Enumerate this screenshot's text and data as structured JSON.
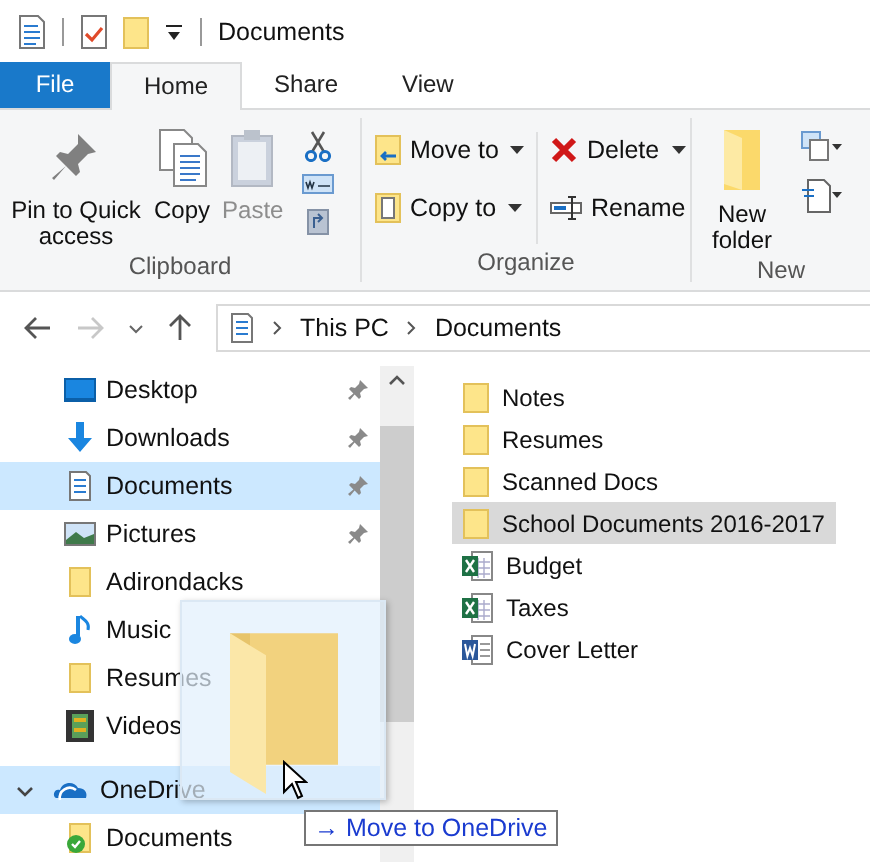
{
  "title_bar": {
    "title": "Documents"
  },
  "tabs": [
    {
      "label": "File",
      "kind": "file",
      "selected": false
    },
    {
      "label": "Home",
      "kind": "tab",
      "selected": true
    },
    {
      "label": "Share",
      "kind": "tab",
      "selected": false
    },
    {
      "label": "View",
      "kind": "tab",
      "selected": false
    }
  ],
  "ribbon": {
    "clipboard": {
      "label": "Clipboard",
      "pin": {
        "label": "Pin to Quick access",
        "disabled": false
      },
      "copy": {
        "label": "Copy",
        "disabled": false
      },
      "paste": {
        "label": "Paste",
        "disabled": true
      }
    },
    "organize": {
      "label": "Organize",
      "move_to": "Move to",
      "copy_to": "Copy to",
      "delete": "Delete",
      "rename": "Rename"
    },
    "new": {
      "label": "New",
      "new_folder": "New folder"
    }
  },
  "address": {
    "crumbs": [
      "This PC",
      "Documents"
    ]
  },
  "nav": [
    {
      "label": "Desktop",
      "kind": "desktop",
      "pinned": true,
      "selected": false
    },
    {
      "label": "Downloads",
      "kind": "downloads",
      "pinned": true,
      "selected": false
    },
    {
      "label": "Documents",
      "kind": "documents",
      "pinned": true,
      "selected": true
    },
    {
      "label": "Pictures",
      "kind": "pictures",
      "pinned": true,
      "selected": false
    },
    {
      "label": "Adirondacks",
      "kind": "folder",
      "pinned": false,
      "selected": false
    },
    {
      "label": "Music",
      "kind": "music",
      "pinned": false,
      "selected": false
    },
    {
      "label": "Resumes",
      "kind": "folder",
      "pinned": false,
      "selected": false
    },
    {
      "label": "Videos",
      "kind": "videos",
      "pinned": false,
      "selected": false
    }
  ],
  "onedrive": {
    "label": "OneDrive",
    "expanded": true,
    "drop_target": true,
    "children": [
      {
        "label": "Documents",
        "kind": "synced-folder"
      }
    ]
  },
  "files": [
    {
      "name": "Notes",
      "kind": "folder",
      "selected": false
    },
    {
      "name": "Resumes",
      "kind": "folder",
      "selected": false
    },
    {
      "name": "Scanned Docs",
      "kind": "folder",
      "selected": false
    },
    {
      "name": "School Documents 2016-2017",
      "kind": "folder",
      "selected": true
    },
    {
      "name": "Budget",
      "kind": "excel",
      "selected": false
    },
    {
      "name": "Taxes",
      "kind": "excel",
      "selected": false
    },
    {
      "name": "Cover Letter",
      "kind": "word",
      "selected": false
    }
  ],
  "drag": {
    "tooltip": "→ Move to OneDrive"
  }
}
